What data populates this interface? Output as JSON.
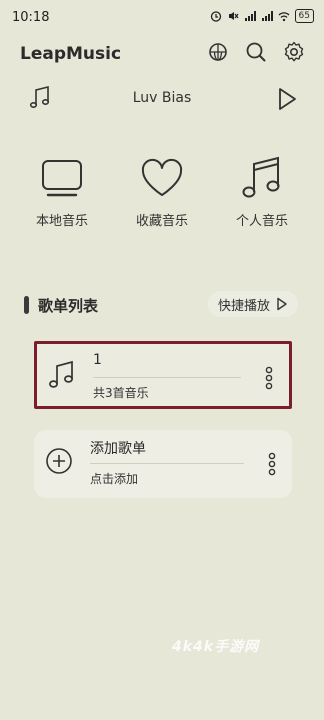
{
  "status_bar": {
    "time": "10:18",
    "battery": "65"
  },
  "header": {
    "app_title": "LeapMusic"
  },
  "now_playing": {
    "title": "Luv Bias"
  },
  "quick_access": [
    {
      "label": "本地音乐",
      "icon": "monitor-icon"
    },
    {
      "label": "收藏音乐",
      "icon": "heart-icon"
    },
    {
      "label": "个人音乐",
      "icon": "music-note-icon"
    }
  ],
  "playlist_section": {
    "title": "歌单列表",
    "quick_play_label": "快捷播放"
  },
  "playlists": [
    {
      "name": "1",
      "subtitle": "共3首音乐"
    }
  ],
  "add_playlist": {
    "title": "添加歌单",
    "subtitle": "点击添加"
  },
  "watermark": "4k4k手游网",
  "colors": {
    "background": "#e6e7d7",
    "card": "#eeeee4",
    "highlight_border": "#7b1e2b"
  }
}
